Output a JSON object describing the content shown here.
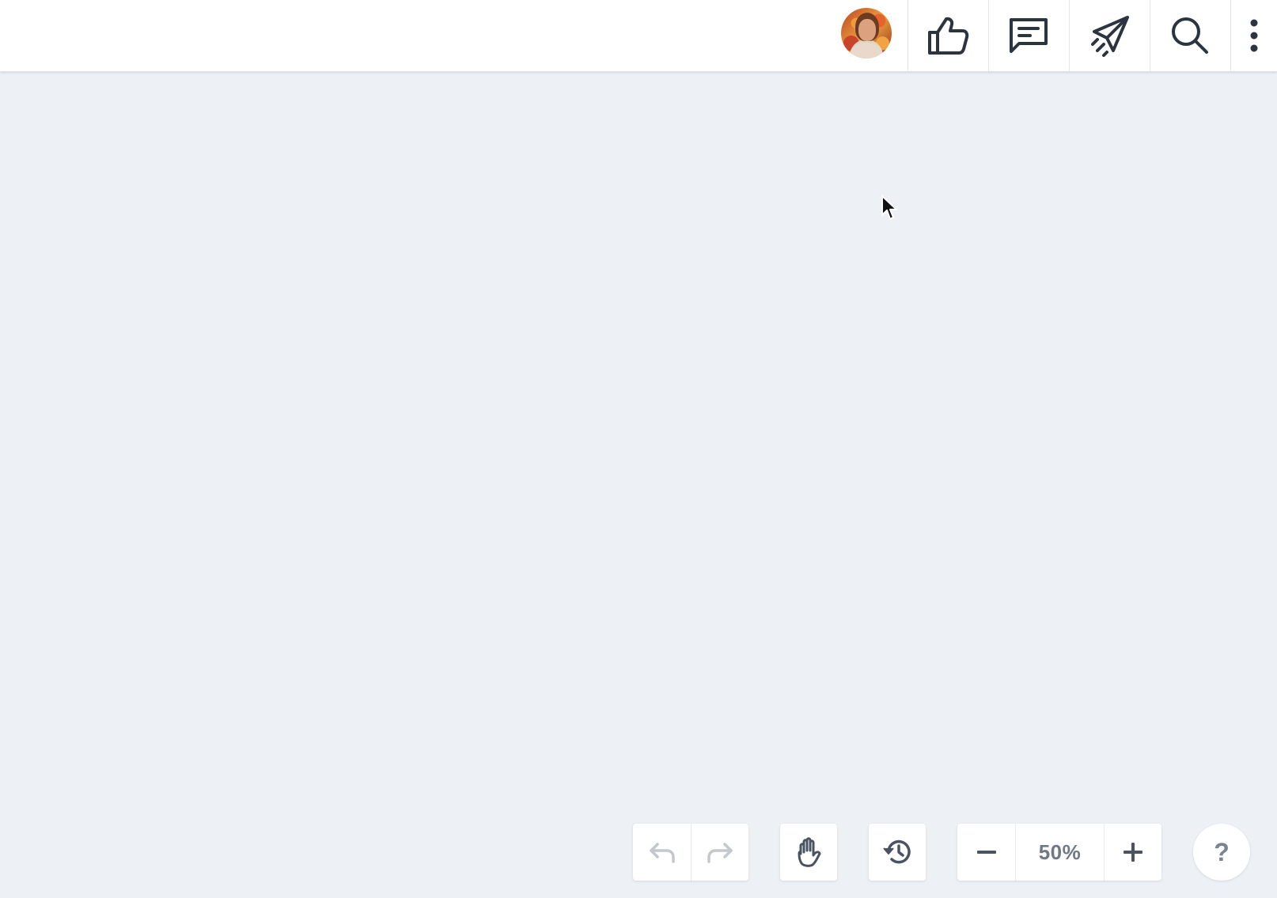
{
  "header": {
    "avatar_icon": "user-avatar",
    "actions": [
      {
        "name": "like",
        "icon": "thumbs-up-icon"
      },
      {
        "name": "comment",
        "icon": "comment-icon"
      },
      {
        "name": "share",
        "icon": "paper-plane-icon"
      },
      {
        "name": "search",
        "icon": "search-icon"
      },
      {
        "name": "more",
        "icon": "more-vertical-icon"
      }
    ]
  },
  "canvas": {
    "background_color": "#edf0f4"
  },
  "toolbar": {
    "undo_icon": "undo-icon",
    "redo_icon": "redo-icon",
    "hand_icon": "hand-icon",
    "history_icon": "history-icon",
    "zoom_out_icon": "minus-icon",
    "zoom_level": "50%",
    "zoom_in_icon": "plus-icon",
    "help_label": "?"
  },
  "colors": {
    "icon_dark": "#2b3440",
    "icon_muted": "#6f7885",
    "icon_disabled": "#c3c8cf"
  }
}
